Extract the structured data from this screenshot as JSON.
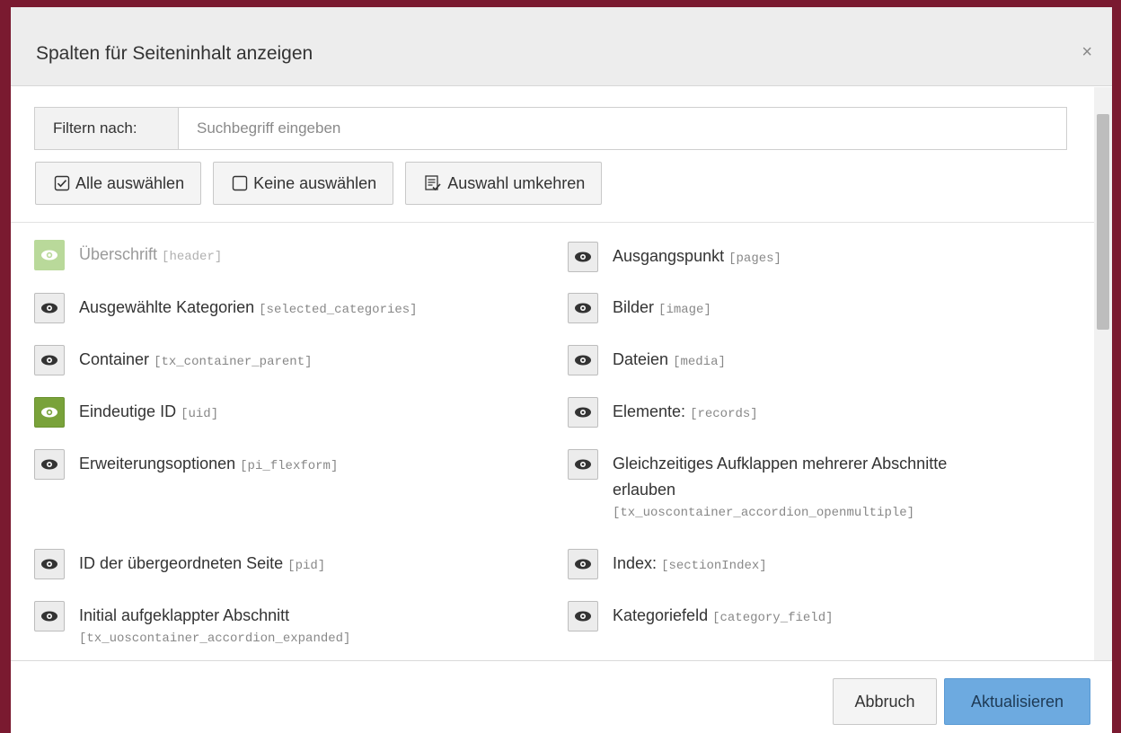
{
  "modal": {
    "title": "Spalten für Seiteninhalt anzeigen",
    "close_label": "×"
  },
  "filter": {
    "label": "Filtern nach:",
    "placeholder": "Suchbegriff eingeben",
    "value": ""
  },
  "toolbar": {
    "select_all": {
      "label": "Alle auswählen",
      "icon": "checkbox-checked-icon"
    },
    "select_none": {
      "label": "Keine auswählen",
      "icon": "checkbox-empty-icon"
    },
    "invert": {
      "label": "Auswahl umkehren",
      "icon": "invert-selection-icon"
    }
  },
  "fields": [
    {
      "label": "Überschrift",
      "key": "[header]",
      "state": "disabled"
    },
    {
      "label": "Ausgangspunkt",
      "key": "[pages]",
      "state": "off"
    },
    {
      "label": "Ausgewählte Kategorien",
      "key": "[selected_categories]",
      "state": "off"
    },
    {
      "label": "Bilder",
      "key": "[image]",
      "state": "off"
    },
    {
      "label": "Container",
      "key": "[tx_container_parent]",
      "state": "off"
    },
    {
      "label": "Dateien",
      "key": "[media]",
      "state": "off"
    },
    {
      "label": "Eindeutige ID",
      "key": "[uid]",
      "state": "on"
    },
    {
      "label": "Elemente:",
      "key": "[records]",
      "state": "off"
    },
    {
      "label": "Erweiterungsoptionen",
      "key": "[pi_flexform]",
      "state": "off"
    },
    {
      "label": "Gleichzeitiges Aufklappen mehrerer Abschnitte",
      "label_line2": "erlauben",
      "key": "[tx_uoscontainer_accordion_openmultiple]",
      "state": "off"
    },
    {
      "label": "ID der übergeordneten Seite",
      "key": "[pid]",
      "state": "off"
    },
    {
      "label": "Index:",
      "key": "[sectionIndex]",
      "state": "off"
    },
    {
      "label": "Initial aufgeklappter Abschnitt",
      "key": "[tx_uoscontainer_accordion_expanded]",
      "state": "off"
    },
    {
      "label": "Kategoriefeld",
      "key": "[category_field]",
      "state": "off"
    }
  ],
  "footer": {
    "cancel_label": "Abbruch",
    "update_label": "Aktualisieren"
  },
  "colors": {
    "frame": "#7a1a30",
    "active_green": "#79a23a",
    "primary_blue": "#6daae0"
  }
}
